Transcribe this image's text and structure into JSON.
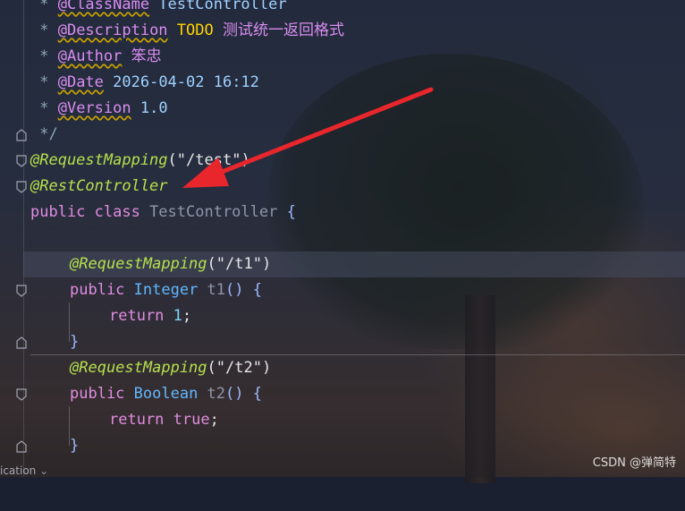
{
  "editor": {
    "lines": {
      "l1_star": " * ",
      "l1_tag": "@ClassName",
      "l1_rest": " TestController",
      "l2_star": " * ",
      "l2_tag": "@Description",
      "l2_todo": " TODO ",
      "l2_cn": "测试统一返回格式",
      "l3_star": " * ",
      "l3_tag": "@Author",
      "l3_cn": " 笨忠",
      "l4_star": " * ",
      "l4_tag": "@Date",
      "l4_rest": " 2026-04-02 16:12",
      "l5_star": " * ",
      "l5_tag": "@Version",
      "l5_rest": " 1.0",
      "l6": " */",
      "l7_ann": "@RequestMapping",
      "l7_paren1": "(",
      "l7_str": "\"/test\"",
      "l7_paren2": ")",
      "l8_ann": "@RestController",
      "l9_kw": "public class ",
      "l9_name": "TestController",
      "l9_brace": " {",
      "l11_ann": "@RequestMapping",
      "l11_paren1": "(",
      "l11_str": "\"/t1\"",
      "l11_paren2": ")",
      "l12_kw": "public ",
      "l12_type": "Integer",
      "l12_name": " t1",
      "l12_rest": "() {",
      "l13_kw": "return ",
      "l13_num": "1",
      "l13_semi": ";",
      "l14": "}",
      "l15_ann": "@RequestMapping",
      "l15_paren1": "(",
      "l15_str": "\"/t2\"",
      "l15_paren2": ")",
      "l16_kw": "public ",
      "l16_type": "Boolean",
      "l16_name": " t2",
      "l16_rest": "() {",
      "l17_kw": "return ",
      "l17_val": "true",
      "l17_semi": ";",
      "l18": "}"
    }
  },
  "status_fragment": "ication",
  "watermark": "CSDN @弹简特",
  "colors": {
    "arrow": "#e8262c",
    "annotation": "#b6e04c",
    "keyword": "#e08ce0"
  }
}
